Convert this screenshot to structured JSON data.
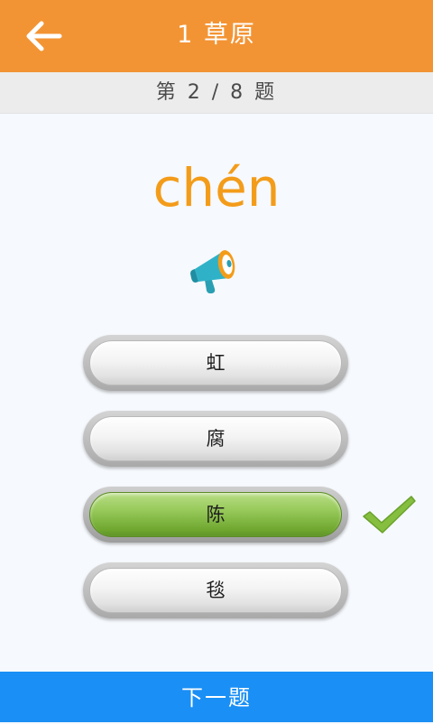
{
  "header": {
    "title": "1 草原",
    "back_icon": "arrow-left-icon"
  },
  "progress": {
    "text": "第 2 / 8 题"
  },
  "question": {
    "pinyin": "chén",
    "speaker_icon": "megaphone-icon"
  },
  "options": [
    {
      "label": "虹",
      "state": "default"
    },
    {
      "label": "腐",
      "state": "default"
    },
    {
      "label": "陈",
      "state": "correct"
    },
    {
      "label": "毯",
      "state": "default"
    }
  ],
  "result_icon": "checkmark-icon",
  "footer": {
    "next_label": "下一题"
  },
  "colors": {
    "header": "#f39434",
    "pinyin": "#f39c1a",
    "correct": "#8cc152",
    "next_button": "#1a8ff5"
  }
}
